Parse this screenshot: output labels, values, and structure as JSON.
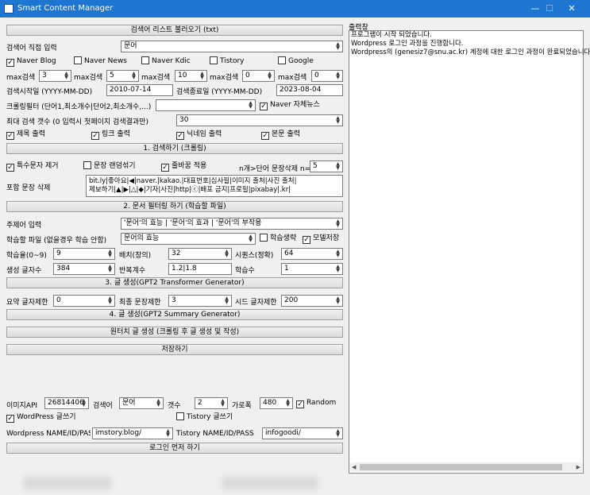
{
  "window": {
    "title": "Smart Content Manager",
    "min": "—",
    "max": "☐",
    "close": "✕"
  },
  "sections": {
    "load": "검색어 리스트 불러오기 (txt)",
    "search": "1. 검색하기 (크롤링)",
    "filter": "2. 문서 필터링 하기 (학습할 파일)",
    "gen3": "3. 글 생성(GPT2 Transformer Generator)",
    "gen4": "4. 글 생성(GPT2 Summary Generator)",
    "oneclick": "원터치 글 생성 (크롤링 후 글 생성 및 작성)",
    "save": "저장하기",
    "login": "로그인 먼저 하기"
  },
  "keyword": {
    "label": "검색어 직접 입력",
    "value": "문어"
  },
  "sources": [
    {
      "label": "Naver Blog",
      "checked": true
    },
    {
      "label": "Naver News",
      "checked": false
    },
    {
      "label": "Naver Kdic",
      "checked": false
    },
    {
      "label": "Tistory",
      "checked": false
    },
    {
      "label": "Google",
      "checked": false
    }
  ],
  "maxes": [
    {
      "label": "max검색",
      "value": "3"
    },
    {
      "label": "max검색",
      "value": "5"
    },
    {
      "label": "max검색",
      "value": "10"
    },
    {
      "label": "max검색",
      "value": "0"
    },
    {
      "label": "max검색",
      "value": "0"
    }
  ],
  "dates": {
    "start_label": "검색시작일 (YYYY-MM-DD)",
    "start": "2010-07-14",
    "end_label": "검색종료일 (YYYY-MM-DD)",
    "end": "2023-08-04"
  },
  "crawl_filter": {
    "label": "크롤링필터 (단어1,최소개수|단어2,최소개수,...)",
    "value": "",
    "naver_news": "Naver 자체뉴스"
  },
  "max_count": {
    "label": "최대 검색 갯수 (0 입력시 첫페이지 검색결과만)",
    "value": "30"
  },
  "outputs": [
    {
      "label": "제목 출력",
      "checked": true
    },
    {
      "label": "링크 출력",
      "checked": true
    },
    {
      "label": "닉네임 출력",
      "checked": true
    },
    {
      "label": "본문 출력",
      "checked": true
    }
  ],
  "options": {
    "remove_special": "특수문자 제거",
    "shuffle": "문장 랜덤섞기",
    "spell": "줄바꿈 적용",
    "ndelete": "n개>단어 문장삭제 n=",
    "n_value": "5"
  },
  "include": {
    "label": "포함 문장 삭제",
    "value": "bit.ly|좋아요|◀|naver.|kakao.|대표번호|심사필|이미지 출처|사진 출처|\n제보하기|▲|▶|△|◆|기자|사진|http|ⓒ|배포 금지|프로필|pixabay|.kr|"
  },
  "topic": {
    "label": "주제어 입력",
    "value": "'문어'의 효능 | '문어'의 효과 | '문어'의 부작용"
  },
  "learn_file": {
    "label": "학습할 파일 (없을경우 학습 안함)",
    "value": "문어의 효능",
    "skip": "학습생략",
    "save_model": "모델저장"
  },
  "params": {
    "lr_label": "학습율(0~9)",
    "lr": "9",
    "batch_label": "배치(창의)",
    "batch": "32",
    "seq_label": "시퀀스(정확)",
    "seq": "64",
    "gen_label": "생성 글자수",
    "gen": "384",
    "rep_label": "반복계수",
    "rep": "1.2|1.8",
    "ep_label": "학습수",
    "ep": "1"
  },
  "gen": {
    "sum_label": "요약 글자제한",
    "sum": "0",
    "final_label": "최종 문장제한",
    "final": "3",
    "seed_label": "시드 글자제한",
    "seed": "200"
  },
  "image": {
    "api_label": "이미지API",
    "api": "26814406",
    "kw_label": "검색어",
    "kw": "문어",
    "count_label": "갯수",
    "count": "2",
    "width_label": "가로폭",
    "width": "480",
    "random": "Random"
  },
  "publish": {
    "wp": "WordPress 글쓰기",
    "tistory": "Tistory 글쓰기",
    "wp_label": "Wordpress NAME/ID/PASS",
    "wp_value": "imstory.blog/",
    "ti_label": "Tistory NAME/ID/PASS",
    "ti_value": "infogoodi/"
  },
  "output": {
    "title": "출력창",
    "lines": [
      "프로그램이 시작 되었습니다.",
      "Wordpress 로그인 과정을 진행합니다.",
      "Wordpress의 (genesiz7@snu.ac.kr) 계정에 대한 로그인 과정이 완료되었습니다"
    ]
  }
}
